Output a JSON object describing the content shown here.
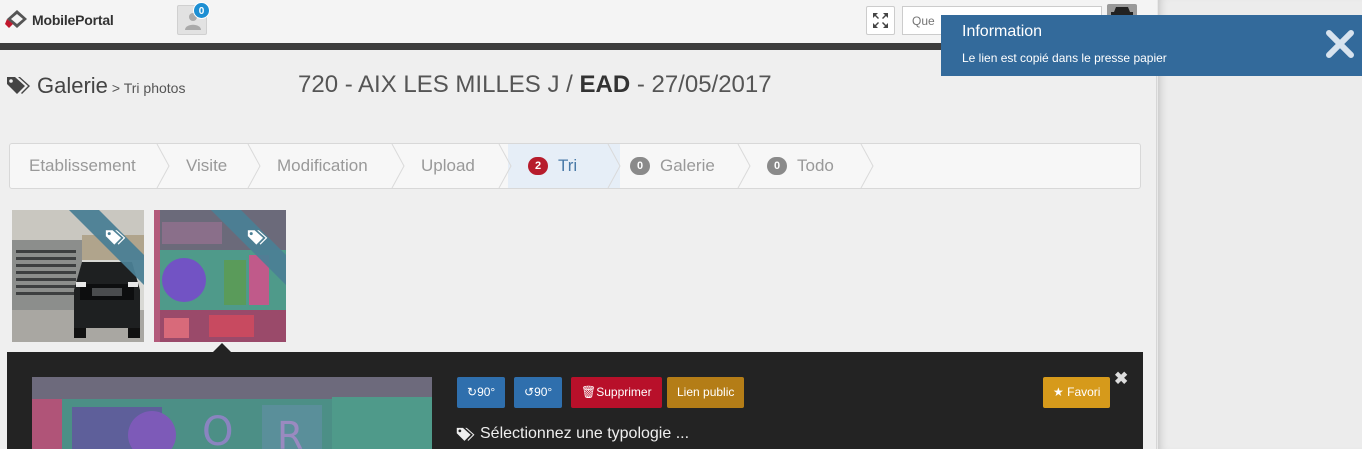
{
  "header": {
    "logo_text": "MobilePortal",
    "notification_count": "0",
    "search_placeholder": "Que"
  },
  "page": {
    "title": "Galerie",
    "subtitle": "> Tri photos",
    "context_prefix": "720 - AIX LES MILLES J / ",
    "context_bold": "EAD",
    "context_suffix": " - 27/05/2017"
  },
  "wizard": {
    "steps": [
      {
        "label": "Etablissement",
        "badge": null,
        "active": false
      },
      {
        "label": "Visite",
        "badge": null,
        "active": false
      },
      {
        "label": "Modification",
        "badge": null,
        "active": false
      },
      {
        "label": "Upload",
        "badge": null,
        "active": false
      },
      {
        "label": "Tri",
        "badge": "2",
        "active": true
      },
      {
        "label": "Galerie",
        "badge": "0",
        "active": false
      },
      {
        "label": "Todo",
        "badge": "0",
        "active": false
      }
    ]
  },
  "thumbnails": [
    {
      "name": "photo-car"
    },
    {
      "name": "photo-storefront",
      "selected": true
    }
  ],
  "panel": {
    "rotate_right_label": "90°",
    "rotate_left_label": "90°",
    "delete_label": "Supprimer",
    "public_link_label": "Lien public",
    "favorite_label": "Favori",
    "typology_prompt": "Sélectionnez une typologie ..."
  },
  "notification": {
    "title": "Information",
    "message": "Le lien est copié dans le presse papier"
  },
  "colors": {
    "accent_blue": "#336a9b",
    "danger": "#b8102a",
    "warning": "#b47d17",
    "favorite": "#d69a1b",
    "badge_blue": "#1d8fd3"
  }
}
